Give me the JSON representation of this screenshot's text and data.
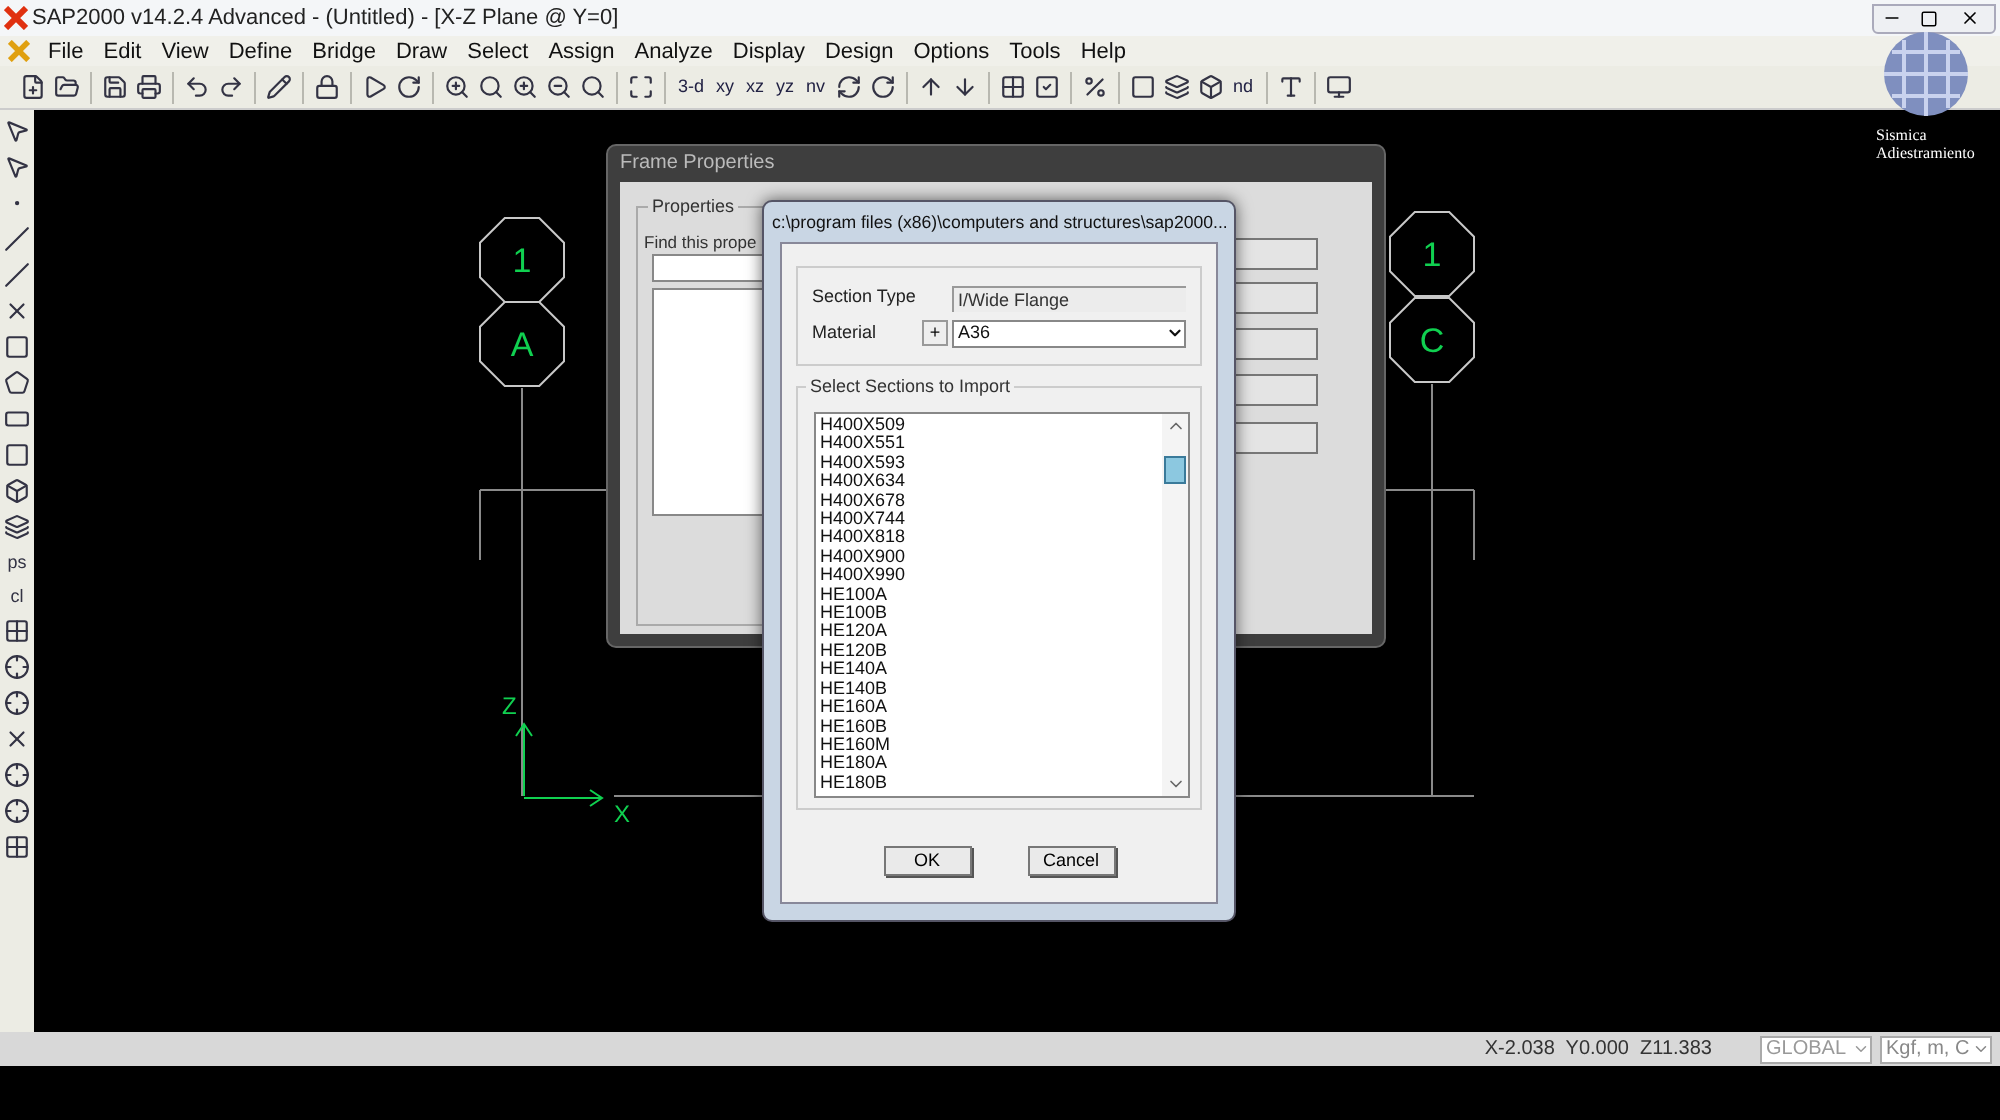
{
  "window": {
    "title": "SAP2000 v14.2.4 Advanced  - (Untitled) - [X-Z Plane @ Y=0]"
  },
  "menu": [
    "File",
    "Edit",
    "View",
    "Define",
    "Bridge",
    "Draw",
    "Select",
    "Assign",
    "Analyze",
    "Display",
    "Design",
    "Options",
    "Tools",
    "Help"
  ],
  "toolbar": {
    "view_buttons": [
      "3-d",
      "xy",
      "xz",
      "yz",
      "nv"
    ],
    "nd_button": "nd"
  },
  "side_toolbar": {
    "text_tools": [
      "ps",
      "cl"
    ]
  },
  "canvas": {
    "bubbles": [
      {
        "label": "1"
      },
      {
        "label": "A"
      },
      {
        "label": "1"
      },
      {
        "label": "C"
      }
    ],
    "axes": [
      "Z",
      "X"
    ]
  },
  "logo": {
    "lines": [
      "Sismica",
      "Adiestramiento"
    ]
  },
  "frame_properties": {
    "title": "Frame Properties",
    "group": "Properties",
    "find_label": "Find this prope"
  },
  "import_dialog": {
    "title": "c:\\program files (x86)\\computers and structures\\sap2000...",
    "section_type_label": "Section Type",
    "section_type": "I/Wide Flange",
    "material_label": "Material",
    "add_button": "+",
    "material": "A36",
    "group": "Select Sections to Import",
    "sections": [
      "H400X509",
      "H400X551",
      "H400X593",
      "H400X634",
      "H400X678",
      "H400X744",
      "H400X818",
      "H400X900",
      "H400X990",
      "HE100A",
      "HE100B",
      "HE120A",
      "HE120B",
      "HE140A",
      "HE140B",
      "HE160A",
      "HE160B",
      "HE160M",
      "HE180A",
      "HE180B"
    ],
    "buttons": [
      "OK",
      "Cancel"
    ]
  },
  "status_bar": {
    "coordinates": "X-2.038  Y0.000  Z11.383",
    "coord_system": "GLOBAL",
    "units": "Kgf, m, C"
  }
}
